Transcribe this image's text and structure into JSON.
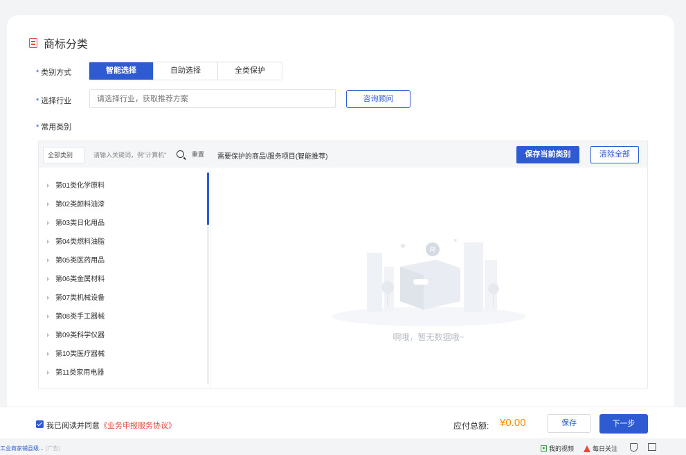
{
  "section": {
    "title": "商标分类"
  },
  "category_mode": {
    "label": "类别方式",
    "options": [
      "智能选择",
      "自助选择",
      "全类保护"
    ],
    "selected": "智能选择"
  },
  "industry": {
    "label": "选择行业",
    "placeholder": "请选择行业，获取推荐方案",
    "consult_button": "咨询顾问"
  },
  "common": {
    "label": "常用类别"
  },
  "picker": {
    "all_categories": "全部类别",
    "keyword_placeholder": "请输入关键词，例\"计算机\"",
    "reset": "重置",
    "right_title": "需要保护的商品\\服务项目(智能推荐)",
    "save_current": "保存当前类别",
    "clear_all": "清除全部",
    "categories": [
      "第01类化学原料",
      "第02类颜料油漆",
      "第03类日化用品",
      "第04类燃料油脂",
      "第05类医药用品",
      "第06类金属材料",
      "第07类机械设备",
      "第08类手工器械",
      "第09类科学仪器",
      "第10类医疗器械",
      "第11类家用电器"
    ],
    "empty_text": "啊哦，暂无数据哦~"
  },
  "footer": {
    "agree_prefix": "我已阅读并同意",
    "agree_link": "《业务申报服务协议》",
    "agreed": true,
    "total_label": "应付总额:",
    "total_amount": "¥0.00",
    "save_button": "保存",
    "next_button": "下一步"
  },
  "bottom_bar": {
    "left_text": "工业商家铺县级...",
    "left_suffix": "(广告)",
    "video_label": "我的视频",
    "follow_label": "每日关注"
  },
  "colors": {
    "primary": "#2f5bd2",
    "accent": "#e8493b",
    "price": "#ff8a00"
  }
}
